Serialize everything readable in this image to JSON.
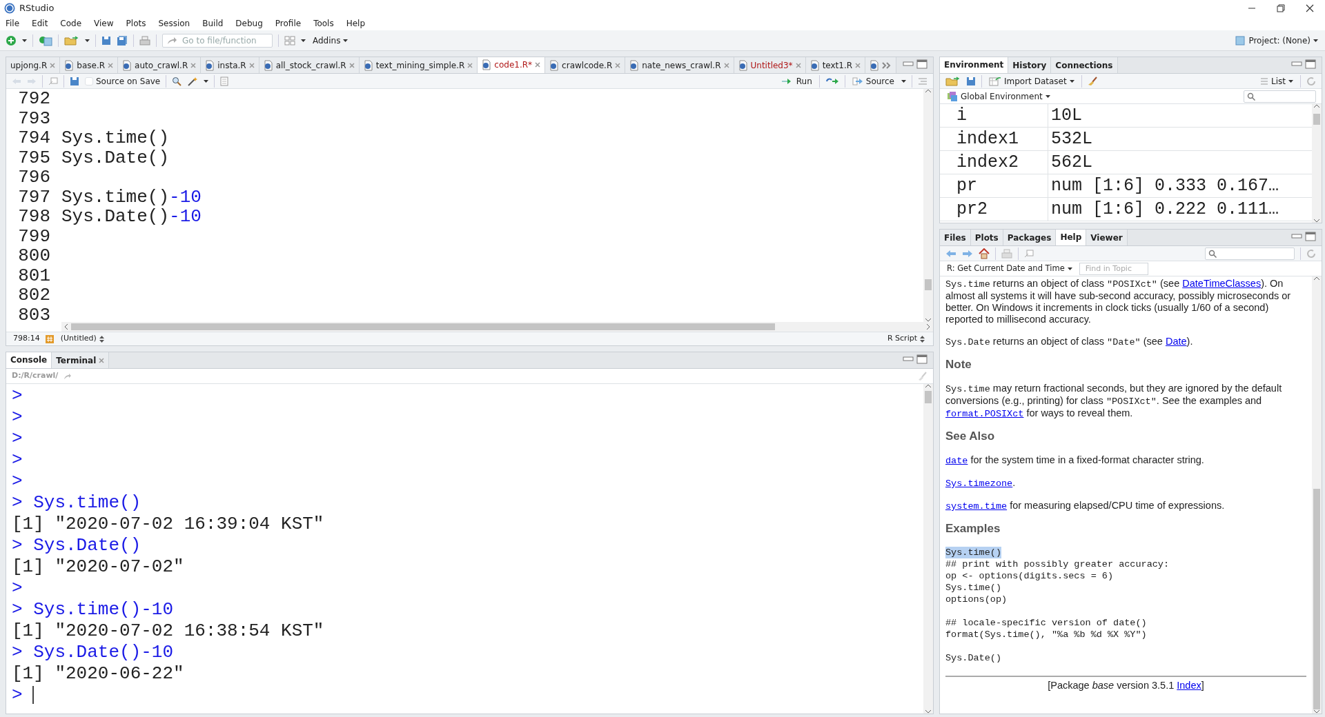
{
  "window": {
    "title": "RStudio"
  },
  "menu": [
    "File",
    "Edit",
    "Code",
    "View",
    "Plots",
    "Session",
    "Build",
    "Debug",
    "Profile",
    "Tools",
    "Help"
  ],
  "toolbar": {
    "goto_placeholder": "Go to file/function",
    "addins": "Addins",
    "project": "Project: (None)"
  },
  "editor": {
    "tabs": [
      {
        "label": "upjong.R",
        "selected": false,
        "modified": false
      },
      {
        "label": "base.R",
        "selected": false,
        "modified": false
      },
      {
        "label": "auto_crawl.R",
        "selected": false,
        "modified": false
      },
      {
        "label": "insta.R",
        "selected": false,
        "modified": false
      },
      {
        "label": "all_stock_crawl.R",
        "selected": false,
        "modified": false
      },
      {
        "label": "text_mining_simple.R",
        "selected": false,
        "modified": false
      },
      {
        "label": "code1.R*",
        "selected": true,
        "modified": true
      },
      {
        "label": "crawlcode.R",
        "selected": false,
        "modified": false
      },
      {
        "label": "nate_news_crawl.R",
        "selected": false,
        "modified": false
      },
      {
        "label": "Untitled3*",
        "selected": false,
        "modified": true
      },
      {
        "label": "text1.R",
        "selected": false,
        "modified": false
      }
    ],
    "source_on_save": {
      "label": "Source on Save",
      "checked": false
    },
    "run": "Run",
    "source": "Source",
    "lines": [
      {
        "number": "792"
      },
      {
        "number": "793"
      },
      {
        "number": "794",
        "code": [
          {
            "kind": "plain",
            "text": "Sys.time()"
          }
        ]
      },
      {
        "number": "795",
        "code": [
          {
            "kind": "plain",
            "text": "Sys.Date()"
          }
        ]
      },
      {
        "number": "796"
      },
      {
        "number": "797",
        "code": [
          {
            "kind": "plain",
            "text": "Sys.time()"
          },
          {
            "kind": "number",
            "text": "-10"
          }
        ]
      },
      {
        "number": "798",
        "code": [
          {
            "kind": "plain",
            "text": "Sys.Date()"
          },
          {
            "kind": "number",
            "text": "-10"
          }
        ]
      },
      {
        "number": "799"
      },
      {
        "number": "800"
      },
      {
        "number": "801"
      },
      {
        "number": "802"
      },
      {
        "number": "803"
      }
    ],
    "cursor": "798:14",
    "scope": "(Untitled)",
    "file_type": "R Script"
  },
  "console": {
    "tabs": [
      {
        "label": "Console",
        "selected": true,
        "closable": false
      },
      {
        "label": "Terminal",
        "selected": false,
        "closable": true
      }
    ],
    "path": "D:/R/crawl/",
    "lines": [
      {
        "kind": "input",
        "prompt": ">"
      },
      {
        "kind": "input",
        "prompt": ">"
      },
      {
        "kind": "input",
        "prompt": ">"
      },
      {
        "kind": "input",
        "prompt": ">"
      },
      {
        "kind": "input",
        "prompt": ">"
      },
      {
        "kind": "input",
        "prompt": ">",
        "text": "Sys.time()"
      },
      {
        "kind": "output",
        "text": "[1] \"2020-07-02 16:39:04 KST\""
      },
      {
        "kind": "input",
        "prompt": ">",
        "text": "Sys.Date()"
      },
      {
        "kind": "output",
        "text": "[1] \"2020-07-02\""
      },
      {
        "kind": "input",
        "prompt": ">"
      },
      {
        "kind": "input",
        "prompt": ">",
        "text": "Sys.time()-10"
      },
      {
        "kind": "output",
        "text": "[1] \"2020-07-02 16:38:54 KST\""
      },
      {
        "kind": "input",
        "prompt": ">",
        "text": "Sys.Date()-10"
      },
      {
        "kind": "output",
        "text": "[1] \"2020-06-22\""
      },
      {
        "kind": "cursor",
        "prompt": ">"
      }
    ]
  },
  "environment": {
    "tabs": [
      {
        "label": "Environment",
        "selected": true
      },
      {
        "label": "History",
        "selected": false
      },
      {
        "label": "Connections",
        "selected": false
      }
    ],
    "import": "Import Dataset",
    "view": "List",
    "scope": "Global Environment",
    "rows": [
      {
        "name": "i",
        "value": "10L"
      },
      {
        "name": "index1",
        "value": "532L"
      },
      {
        "name": "index2",
        "value": "562L"
      },
      {
        "name": "pr",
        "value": "num [1:6] 0.333 0.167…"
      },
      {
        "name": "pr2",
        "value": "num [1:6] 0.222 0.111…"
      }
    ]
  },
  "help": {
    "tabs": [
      {
        "label": "Files",
        "selected": false
      },
      {
        "label": "Plots",
        "selected": false
      },
      {
        "label": "Packages",
        "selected": false
      },
      {
        "label": "Help",
        "selected": true
      },
      {
        "label": "Viewer",
        "selected": false
      }
    ],
    "topic": "R: Get Current Date and Time",
    "find_placeholder": "Find in Topic",
    "blocks": [
      {
        "kind": "para",
        "parts": [
          {
            "kind": "code",
            "text": "Sys.time"
          },
          {
            "kind": "text",
            "text": " returns an object of class "
          },
          {
            "kind": "code",
            "text": "\"POSIXct\""
          },
          {
            "kind": "text",
            "text": " (see "
          },
          {
            "kind": "link",
            "text": "DateTimeClasses"
          },
          {
            "kind": "text",
            "text": "). On almost all systems it will have sub-second accuracy, possibly microseconds or better. On Windows it increments in clock ticks (usually 1/60 of a second) reported to millisecond accuracy."
          }
        ]
      },
      {
        "kind": "para",
        "parts": [
          {
            "kind": "code",
            "text": "Sys.Date"
          },
          {
            "kind": "text",
            "text": " returns an object of class "
          },
          {
            "kind": "code",
            "text": "\"Date\""
          },
          {
            "kind": "text",
            "text": " (see "
          },
          {
            "kind": "link",
            "text": "Date"
          },
          {
            "kind": "text",
            "text": ")."
          }
        ]
      },
      {
        "kind": "heading",
        "text": "Note"
      },
      {
        "kind": "para",
        "parts": [
          {
            "kind": "code",
            "text": "Sys.time"
          },
          {
            "kind": "text",
            "text": " may return fractional seconds, but they are ignored by the default conversions (e.g., printing) for class "
          },
          {
            "kind": "code",
            "text": "\"POSIXct\""
          },
          {
            "kind": "text",
            "text": ". See the examples and "
          },
          {
            "kind": "codelink",
            "text": "format.POSIXct"
          },
          {
            "kind": "text",
            "text": " for ways to reveal them."
          }
        ]
      },
      {
        "kind": "heading",
        "text": "See Also"
      },
      {
        "kind": "para",
        "parts": [
          {
            "kind": "codelink",
            "text": "date"
          },
          {
            "kind": "text",
            "text": " for the system time in a fixed-format character string."
          }
        ]
      },
      {
        "kind": "para",
        "parts": [
          {
            "kind": "codelink",
            "text": "Sys.timezone"
          },
          {
            "kind": "text",
            "text": "."
          }
        ]
      },
      {
        "kind": "para",
        "parts": [
          {
            "kind": "codelink",
            "text": "system.time"
          },
          {
            "kind": "text",
            "text": " for measuring elapsed/CPU time of expressions."
          }
        ]
      },
      {
        "kind": "heading",
        "text": "Examples"
      },
      {
        "kind": "example",
        "lines": [
          {
            "text": "Sys.time()",
            "selected": true
          },
          {
            "text": "## print with possibly greater accuracy:",
            "selected": false
          },
          {
            "text": "op <- options(digits.secs = 6)",
            "selected": false
          },
          {
            "text": "Sys.time()",
            "selected": false
          },
          {
            "text": "options(op)",
            "selected": false
          }
        ]
      },
      {
        "kind": "example",
        "lines": [
          {
            "text": "## locale-specific version of date()",
            "selected": false
          },
          {
            "text": "format(Sys.time(), \"%a %b %d %X %Y\")",
            "selected": false
          }
        ]
      },
      {
        "kind": "example",
        "lines": [
          {
            "text": "Sys.Date()",
            "selected": false
          }
        ]
      }
    ],
    "footer": [
      {
        "kind": "text",
        "text": "[Package *base* version 3.5.1 "
      },
      {
        "kind": "link",
        "text": "Index"
      },
      {
        "kind": "text",
        "text": "]"
      }
    ]
  }
}
